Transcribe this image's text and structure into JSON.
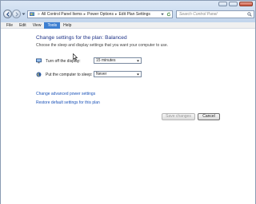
{
  "address_bar": {
    "crumbs": [
      "All Control Panel Items",
      "Power Options",
      "Edit Plan Settings"
    ]
  },
  "search": {
    "placeholder": "Search Control Panel"
  },
  "menubar": {
    "items": [
      "File",
      "Edit",
      "View",
      "Tools",
      "Help"
    ],
    "active_index": 3
  },
  "main": {
    "heading": "Change settings for the plan: Balanced",
    "subheading": "Choose the sleep and display settings that you want your computer to use.",
    "display_label": "Turn off the display:",
    "display_value": "15 minutes",
    "sleep_label": "Put the computer to sleep:",
    "sleep_value": "Never",
    "link_advanced": "Change advanced power settings",
    "link_restore": "Restore default settings for this plan",
    "save_label": "Save changes",
    "cancel_label": "Cancel"
  },
  "icons": {
    "back": "back-arrow-icon",
    "forward": "forward-arrow-icon",
    "control_panel": "control-panel-icon",
    "refresh": "refresh-icon",
    "search": "search-icon",
    "display": "monitor-icon",
    "sleep": "sleep-moon-icon"
  },
  "colors": {
    "heading": "#1e3287",
    "link": "#1a52b8",
    "menu_active": "#3d7fd1"
  }
}
